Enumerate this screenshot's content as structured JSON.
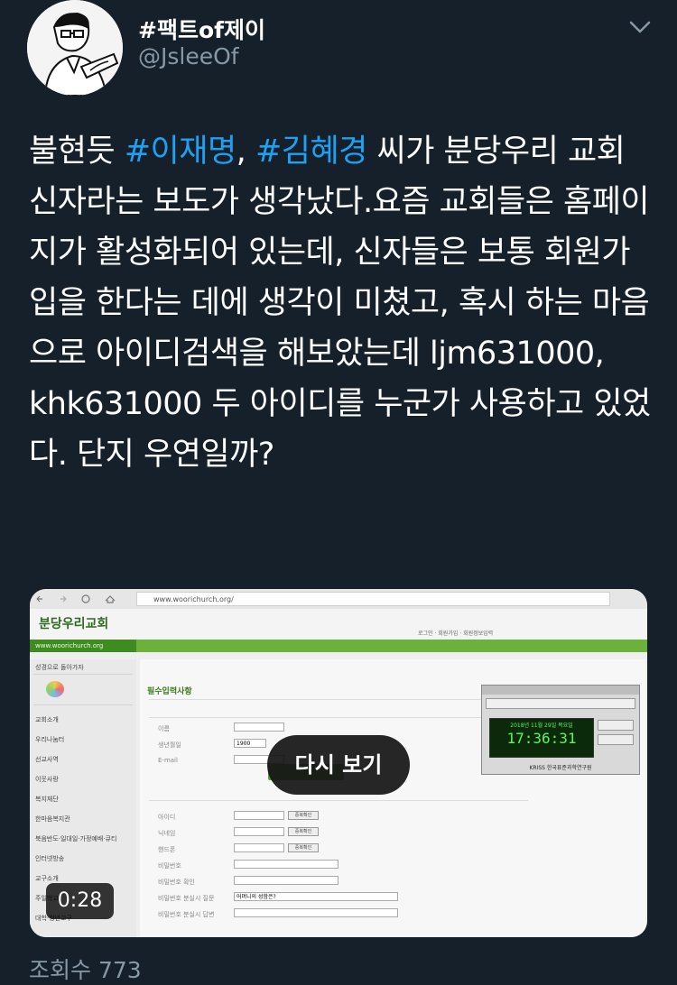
{
  "tweet": {
    "author": {
      "display_name": "#팩트of제이",
      "handle": "@JsleeOf",
      "avatar_icon": "cartoon-man-drawing-avatar"
    },
    "menu_icon": "chevron-down-icon",
    "text": {
      "part1": "불현듯 ",
      "hashtag1": "#이재명",
      "part2": ", ",
      "hashtag2": "#김혜경",
      "part3": " 씨가 분당우리 교회 신자라는 보도가 생각났다.요즘 교회들은 홈페이지가 활성화되어 있는데, 신자들은 보통 회원가입을 한다는 데에 생각이 미쳤고, 혹시 하는 마음으로  아이디검색을 해보았는데  ljm631000, khk631000 두 아이디를 누군가 사용하고 있었다. 단지 우연일까?"
    },
    "hashtag_color": "#1da1f2",
    "video": {
      "replay_label": "다시 보기",
      "duration": "0:28",
      "screenshot": {
        "url": "www.woorichurch.org/",
        "site_logo": "분당우리교회",
        "site_url_bar": "www.woorichurch.org",
        "form_title": "필수입력사항",
        "sidebar_items": [
          "성경으로 돌아가자",
          "교회소개",
          "우리나눔터",
          "선교사역",
          "이웃사랑",
          "복지재단",
          "한마음복지관",
          "북음반도·일대일·가정예배·큐티",
          "인터넷방송",
          "교구소개",
          "주일학교",
          "대학·청년교구"
        ],
        "field_labels": [
          "이름",
          "생년월일",
          "E-mail",
          "아이디",
          "닉네임",
          "핸드폰",
          "비밀번호",
          "비밀번호 확인",
          "비밀번호 분실시 질문",
          "비밀번호 분실시 답변"
        ],
        "birth_year": "1900",
        "security_question": "어머니의 성함은?",
        "clock_time": "17:36:31",
        "clock_date": "2018년 11월 29일 목요일",
        "clock_org": "KRISS 한국표준과학연구원"
      }
    },
    "views": "조회수 773"
  }
}
